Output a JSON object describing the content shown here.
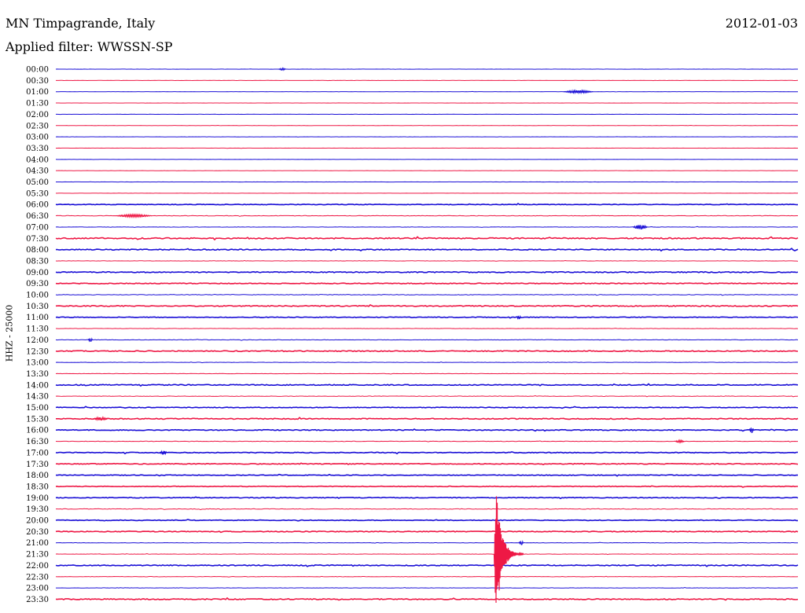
{
  "header": {
    "station": "MN Timpagrande, Italy",
    "date": "2012-01-03",
    "filter_label": "Applied filter: WWSSN-SP"
  },
  "y_axis_label": "HHZ - 25000",
  "colors": {
    "blue_trace": "#1a0fd6",
    "red_trace": "#ee1845",
    "text": "#000000",
    "background": "#ffffff"
  },
  "chart_data": {
    "type": "helicorder",
    "channel": "HHZ",
    "row_minutes": 30,
    "row_labels": [
      "00:00",
      "00:30",
      "01:00",
      "01:30",
      "02:00",
      "02:30",
      "03:00",
      "03:30",
      "04:00",
      "04:30",
      "05:00",
      "05:30",
      "06:00",
      "06:30",
      "07:00",
      "07:30",
      "08:00",
      "08:30",
      "09:00",
      "09:30",
      "10:00",
      "10:30",
      "11:00",
      "11:30",
      "12:00",
      "12:30",
      "13:00",
      "13:30",
      "14:00",
      "14:30",
      "15:00",
      "15:30",
      "16:00",
      "16:30",
      "17:00",
      "17:30",
      "18:00",
      "18:30",
      "19:00",
      "19:30",
      "20:00",
      "20:30",
      "21:00",
      "21:30",
      "22:00",
      "22:30",
      "23:00",
      "23:30"
    ],
    "row_colors": [
      "blue",
      "red",
      "blue",
      "red",
      "blue",
      "red",
      "blue",
      "red",
      "blue",
      "red",
      "blue",
      "red",
      "blue",
      "red",
      "blue",
      "red",
      "blue",
      "red",
      "blue",
      "red",
      "blue",
      "red",
      "blue",
      "red",
      "blue",
      "red",
      "blue",
      "red",
      "blue",
      "red",
      "blue",
      "red",
      "blue",
      "red",
      "blue",
      "red",
      "blue",
      "red",
      "blue",
      "red",
      "blue",
      "red",
      "blue",
      "red",
      "blue",
      "red",
      "blue",
      "red"
    ],
    "noise_level": [
      0.15,
      0.15,
      0.15,
      0.15,
      0.15,
      0.15,
      0.15,
      0.15,
      0.15,
      0.15,
      0.15,
      0.15,
      0.6,
      0.4,
      0.3,
      1.0,
      0.8,
      0.3,
      0.8,
      0.7,
      0.5,
      0.8,
      0.6,
      0.3,
      0.4,
      0.8,
      0.3,
      0.3,
      0.8,
      0.4,
      0.6,
      0.8,
      0.7,
      0.4,
      0.7,
      0.7,
      0.6,
      0.6,
      0.6,
      0.5,
      0.6,
      0.7,
      0.3,
      0.3,
      0.8,
      0.3,
      0.3,
      0.8
    ],
    "events": [
      {
        "row": 0,
        "minute": 9.0,
        "amplitude": 1.2,
        "duration_min": 0.3
      },
      {
        "row": 2,
        "minute": 20.5,
        "amplitude": 1.6,
        "duration_min": 1.2
      },
      {
        "row": 13,
        "minute": 2.4,
        "amplitude": 1.5,
        "duration_min": 1.5
      },
      {
        "row": 14,
        "minute": 23.3,
        "amplitude": 2.6,
        "duration_min": 0.6
      },
      {
        "row": 22,
        "minute": 18.6,
        "amplitude": 2.0,
        "duration_min": 0.2
      },
      {
        "row": 24,
        "minute": 1.3,
        "amplitude": 2.0,
        "duration_min": 0.2
      },
      {
        "row": 31,
        "minute": 1.5,
        "amplitude": 1.8,
        "duration_min": 0.6
      },
      {
        "row": 32,
        "minute": 28.0,
        "amplitude": 3.2,
        "duration_min": 0.2
      },
      {
        "row": 33,
        "minute": 25.0,
        "amplitude": 1.4,
        "duration_min": 0.4
      },
      {
        "row": 34,
        "minute": 4.2,
        "amplitude": 2.2,
        "duration_min": 0.3
      },
      {
        "row": 42,
        "minute": 18.7,
        "amplitude": 2.4,
        "duration_min": 0.2
      },
      {
        "row": 43,
        "minute": 17.7,
        "amplitude": 20.0,
        "duration_min": 4.0
      }
    ],
    "large_event": {
      "row": 43,
      "minute": 17.7,
      "peak_amplitude": 5.8,
      "coda_minutes": 1.2
    }
  }
}
